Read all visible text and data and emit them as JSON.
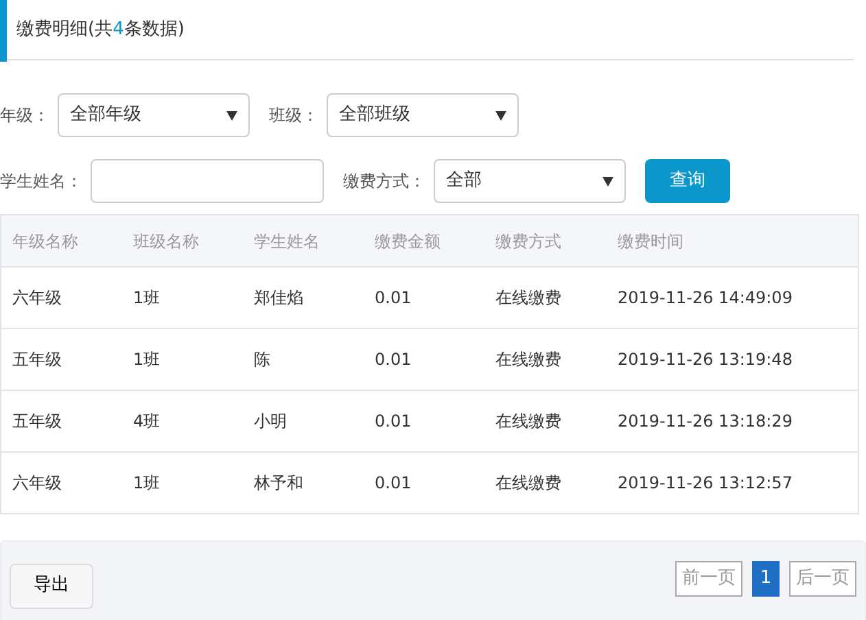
{
  "header": {
    "title_before": "缴费明细(共",
    "count": "4",
    "title_after": "条数据)"
  },
  "filter_rows": [
    [
      {
        "kind": "select",
        "label": "年级：",
        "value": "全部年级"
      },
      {
        "kind": "select",
        "label": "班级：",
        "value": "全部班级"
      }
    ],
    [
      {
        "kind": "input",
        "label": "学生姓名："
      },
      {
        "kind": "select",
        "label": "缴费方式：",
        "value": "全部"
      },
      {
        "kind": "button",
        "label": "查询"
      }
    ]
  ],
  "table": {
    "columns": [
      "年级名称",
      "班级名称",
      "学生姓名",
      "缴费金额",
      "缴费方式",
      "缴费时间"
    ],
    "rows": [
      [
        "六年级",
        "1班",
        "郑佳焰",
        "0.01",
        "在线缴费",
        "2019-11-26 14:49:09"
      ],
      [
        "五年级",
        "1班",
        "陈",
        "0.01",
        "在线缴费",
        "2019-11-26 13:19:48"
      ],
      [
        "五年级",
        "4班",
        "小明",
        "0.01",
        "在线缴费",
        "2019-11-26 13:18:29"
      ],
      [
        "六年级",
        "1班",
        "林予和",
        "0.01",
        "在线缴费",
        "2019-11-26 13:12:57"
      ]
    ]
  },
  "footer": {
    "export_button": "导出",
    "pagination": [
      {
        "label": "前一页",
        "disabled": true,
        "selected": false
      },
      {
        "label": "1",
        "disabled": false,
        "selected": true
      },
      {
        "label": "后一页",
        "disabled": true,
        "selected": false
      }
    ]
  }
}
